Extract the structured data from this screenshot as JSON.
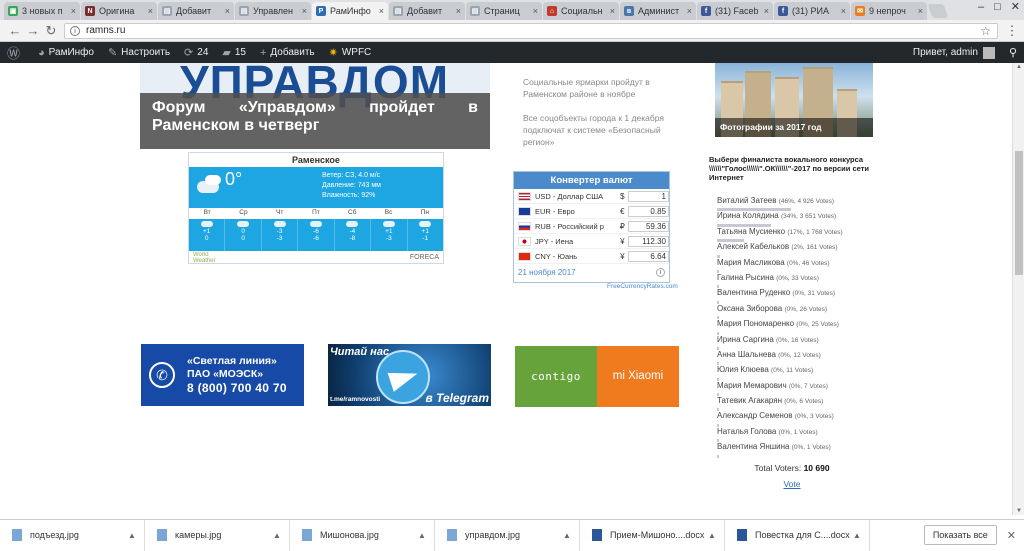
{
  "browser": {
    "tabs": [
      {
        "label": "3 новых п",
        "color": "#3aa757",
        "glyph": "▣",
        "active": false
      },
      {
        "label": "Оригина",
        "color": "#7b2c2c",
        "glyph": "N",
        "active": false
      },
      {
        "label": "Добавит",
        "color": "#9aa5b1",
        "glyph": "▤",
        "active": false
      },
      {
        "label": "Управлен",
        "color": "#9aa5b1",
        "glyph": "▤",
        "active": false
      },
      {
        "label": "РамИнфо",
        "color": "#2c6db4",
        "glyph": "Р",
        "active": true
      },
      {
        "label": "Добавит",
        "color": "#9aa5b1",
        "glyph": "▤",
        "active": false
      },
      {
        "label": "Страниц",
        "color": "#9aa5b1",
        "glyph": "▤",
        "active": false
      },
      {
        "label": "Социальн",
        "color": "#c0392b",
        "glyph": "⌂",
        "active": false
      },
      {
        "label": "Админист",
        "color": "#4a76a8",
        "glyph": "в",
        "active": false
      },
      {
        "label": "(31) Faceb",
        "color": "#3b5998",
        "glyph": "f",
        "active": false
      },
      {
        "label": "(31) РИА",
        "color": "#3b5998",
        "glyph": "f",
        "active": false
      },
      {
        "label": "9 непроч",
        "color": "#e67e22",
        "glyph": "✉",
        "active": false
      }
    ],
    "url": "ramns.ru"
  },
  "adminbar": {
    "site": "РамИнфо",
    "customize": "Настроить",
    "updates": "24",
    "comments": "15",
    "add": "Добавить",
    "plugin": "WPFC",
    "greeting": "Привет, admin"
  },
  "hero": {
    "bigword": "УПРАВДОМ",
    "caption": "Форум «Управдом» пройдет в Раменском в четверг"
  },
  "news": [
    "Социальные ярмарки пройдут в Раменском районе в ноябре",
    "Все соцобъекты города к 1 декабря подключат к системе «Безопасный регион»"
  ],
  "weather": {
    "city": "Раменское",
    "temp": "0°",
    "wind": "Ветер: СЗ, 4.0 м/с",
    "pressure": "Давление: 743 мм",
    "humidity": "Влажность: 92%",
    "days": [
      {
        "name": "Вт",
        "hi": "+1",
        "lo": "0"
      },
      {
        "name": "Ср",
        "hi": "0",
        "lo": "0"
      },
      {
        "name": "Чт",
        "hi": "-3",
        "lo": "-3"
      },
      {
        "name": "Пт",
        "hi": "-6",
        "lo": "-6"
      },
      {
        "name": "Сб",
        "hi": "-4",
        "lo": "-8"
      },
      {
        "name": "Вс",
        "hi": "+1",
        "lo": "-3"
      },
      {
        "name": "Пн",
        "hi": "+1",
        "lo": "-1"
      }
    ],
    "brand_left_1": "World",
    "brand_left_2": "Weather",
    "brand_right": "FORECA"
  },
  "converter": {
    "title": "Конвертер валют",
    "rows": [
      {
        "name": "USD - Доллар США",
        "sym": "$",
        "val": "1"
      },
      {
        "name": "EUR - Евро",
        "sym": "€",
        "val": "0.85"
      },
      {
        "name": "RUB - Российский р",
        "sym": "₽",
        "val": "59.36"
      },
      {
        "name": "JPY - Иена",
        "sym": "¥",
        "val": "112.30"
      },
      {
        "name": "CNY - Юань",
        "sym": "¥",
        "val": "6.64"
      }
    ],
    "date": "21 ноября 2017",
    "info": "i",
    "source": "FreeCurrencyRates.com"
  },
  "photo_caption": "Фотографии за 2017 год",
  "poll": {
    "title": "Выбери финалиста вокального конкурса \\\\\\\\\\\\\"Голос\\\\\\\\\\\\\".ОК\\\\\\\\\\\\\"-2017 по версии сети Интернет",
    "options": [
      {
        "name": "Виталий Затеев",
        "pct": "(46%, 4 926 Votes)",
        "share": 46
      },
      {
        "name": "Ирина Колядина",
        "pct": "(34%, 3 651 Votes)",
        "share": 34
      },
      {
        "name": "Татьяна Мусиенко",
        "pct": "(17%, 1 768 Votes)",
        "share": 17
      },
      {
        "name": "Алексей Кабельков",
        "pct": "(2%, 161 Votes)",
        "share": 2
      },
      {
        "name": "Мария Масликова",
        "pct": "(0%, 46 Votes)",
        "share": 0
      },
      {
        "name": "Галина Рысина",
        "pct": "(0%, 33 Votes)",
        "share": 0
      },
      {
        "name": "Валентина Руденко",
        "pct": "(0%, 31 Votes)",
        "share": 0
      },
      {
        "name": "Оксана Зиборова",
        "pct": "(0%, 26 Votes)",
        "share": 0
      },
      {
        "name": "Мария Пономаренко",
        "pct": "(0%, 25 Votes)",
        "share": 0
      },
      {
        "name": "Ирина Саргина",
        "pct": "(0%, 16 Votes)",
        "share": 0
      },
      {
        "name": "Анна Шальнева",
        "pct": "(0%, 12 Votes)",
        "share": 0
      },
      {
        "name": "Юлия Клюева",
        "pct": "(0%, 11 Votes)",
        "share": 0
      },
      {
        "name": "Мария Мемарович",
        "pct": "(0%, 7 Votes)",
        "share": 0
      },
      {
        "name": "Татевик Агакарян",
        "pct": "(0%, 6 Votes)",
        "share": 0
      },
      {
        "name": "Александр Семенов",
        "pct": "(0%, 3 Votes)",
        "share": 0
      },
      {
        "name": "Наталья Голова",
        "pct": "(0%, 1 Votes)",
        "share": 0
      },
      {
        "name": "Валентина Яншина",
        "pct": "(0%, 1 Votes)",
        "share": 0
      }
    ],
    "total_label": "Total Voters:",
    "total": "10 690",
    "vote": "Vote"
  },
  "banners": {
    "moesk_1": "«Светлая линия»",
    "moesk_2": "ПАО «МОЭСК»",
    "moesk_3": "8 (800) 700 40 70",
    "tg_top": "Читай нас",
    "tg_url": "t.me/ramnovosti",
    "tg_bottom": "в Telegram",
    "contigo": "contigo",
    "xiaomi": "mi Xiaomi"
  },
  "downloads": {
    "items": [
      "подъезд.jpg",
      "камеры.jpg",
      "Мишонова.jpg",
      "управдом.jpg",
      "Прием-Мишоно....docx",
      "Повестка для С....docx"
    ],
    "show_all": "Показать все"
  }
}
